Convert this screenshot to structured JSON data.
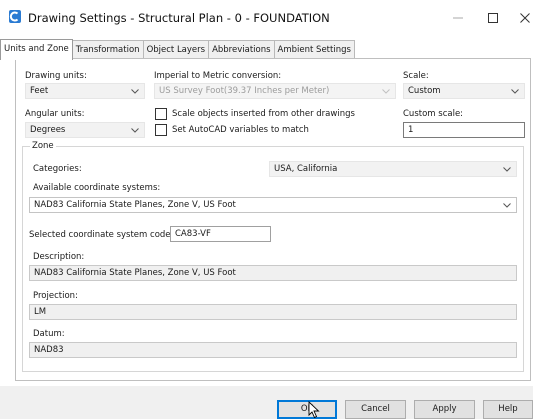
{
  "window": {
    "title": "Drawing Settings - Structural Plan - 0 - FOUNDATION",
    "icons": {
      "app": "app-icon",
      "minimize": "minimize-icon",
      "maximize": "maximize-icon",
      "close": "close-icon"
    }
  },
  "tabs": [
    {
      "label": "Units and Zone",
      "active": true
    },
    {
      "label": "Transformation",
      "active": false
    },
    {
      "label": "Object Layers",
      "active": false
    },
    {
      "label": "Abbreviations",
      "active": false
    },
    {
      "label": "Ambient Settings",
      "active": false
    }
  ],
  "units": {
    "drawing_units_label": "Drawing units:",
    "drawing_units_value": "Feet",
    "conversion_label": "Imperial to Metric conversion:",
    "conversion_value": "US Survey Foot(39.37 Inches per Meter)",
    "scale_label": "Scale:",
    "scale_value": "Custom",
    "angular_units_label": "Angular units:",
    "angular_units_value": "Degrees",
    "scale_objects_label": "Scale objects inserted from other drawings",
    "scale_objects_checked": false,
    "set_autocad_label": "Set AutoCAD variables to match",
    "set_autocad_checked": false,
    "custom_scale_label": "Custom scale:",
    "custom_scale_value": "1"
  },
  "zone": {
    "group_label": "Zone",
    "categories_label": "Categories:",
    "categories_value": "USA, California",
    "available_label": "Available coordinate systems:",
    "available_value": "NAD83 California State Planes, Zone V, US Foot",
    "code_label": "Selected coordinate system code:",
    "code_value": "CA83-VF",
    "description_label": "Description:",
    "description_value": "NAD83 California State Planes, Zone V, US Foot",
    "projection_label": "Projection:",
    "projection_value": "LM",
    "datum_label": "Datum:",
    "datum_value": "NAD83"
  },
  "buttons": {
    "ok": "OK",
    "cancel": "Cancel",
    "apply": "Apply",
    "help": "Help"
  },
  "colors": {
    "focus_accent": "#0078d7",
    "app_icon": "#2b7bd2"
  }
}
